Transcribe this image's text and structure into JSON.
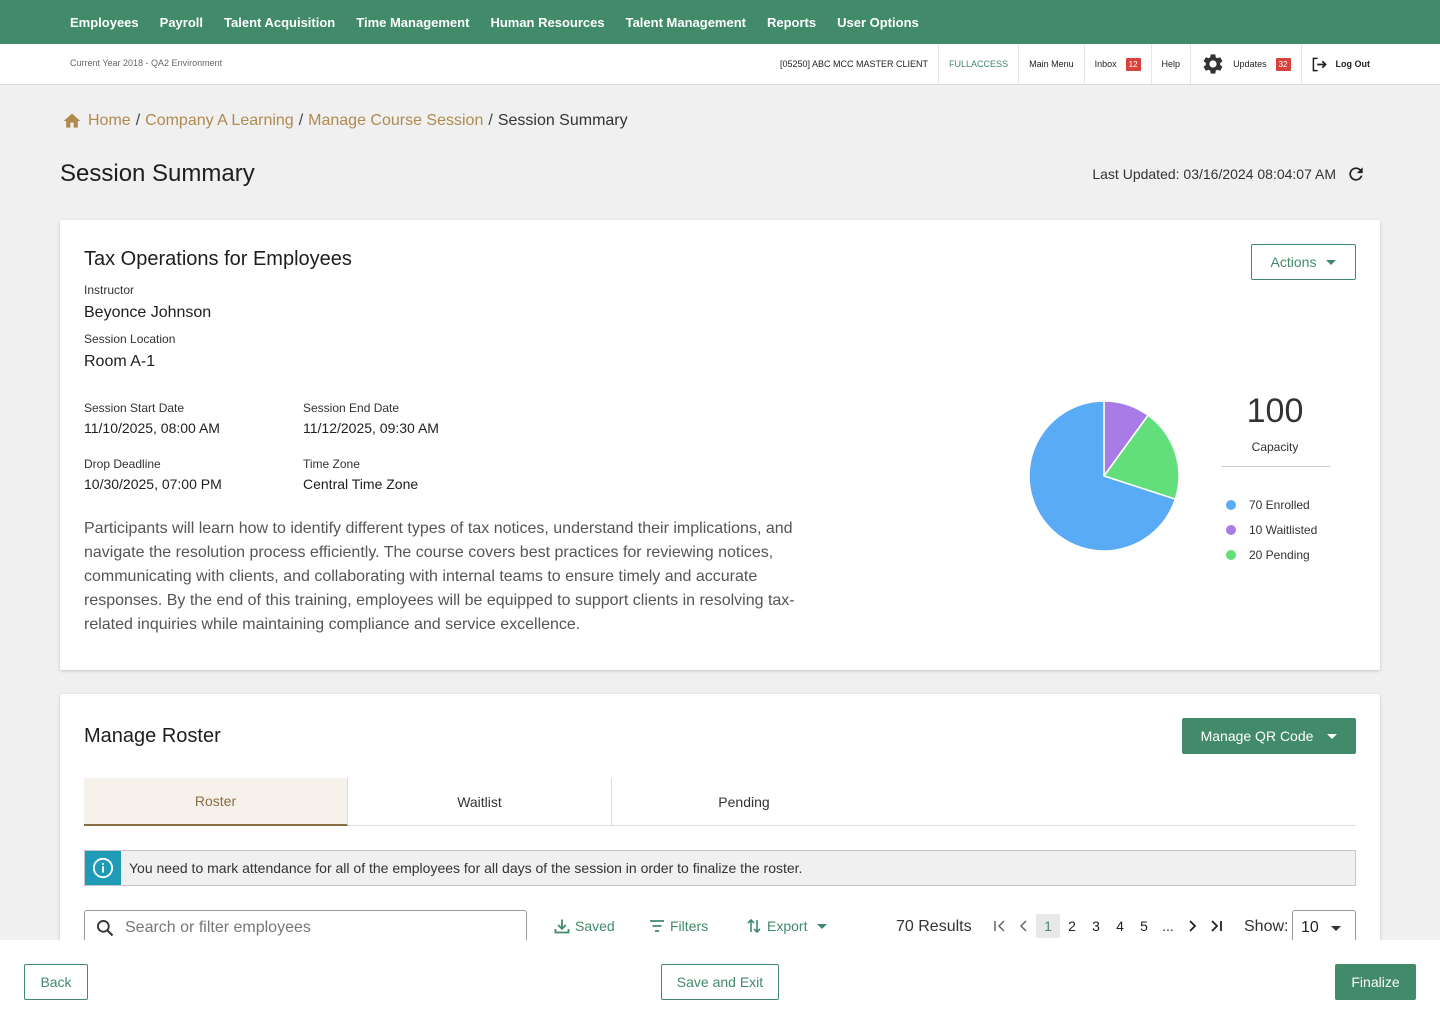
{
  "topnav": {
    "items": [
      "Employees",
      "Payroll",
      "Talent Acquisition",
      "Time Management",
      "Human Resources",
      "Talent Management",
      "Reports",
      "User Options"
    ]
  },
  "utilbar": {
    "environment": "Current Year 2018 - QA2 Environment",
    "client": "[05250] ABC MCC MASTER CLIENT",
    "access": "FULLACCESS",
    "main_menu": "Main Menu",
    "inbox": "Inbox",
    "inbox_count": "12",
    "help": "Help",
    "updates": "Updates",
    "updates_count": "32",
    "logout": "Log Out"
  },
  "breadcrumb": {
    "home": "Home",
    "company": "Company A Learning",
    "manage": "Manage Course Session",
    "current": "Session Summary",
    "separator": "/"
  },
  "page": {
    "title": "Session Summary",
    "last_updated": "Last Updated: 03/16/2024 08:04:07 AM"
  },
  "session": {
    "title": "Tax Operations for Employees",
    "instructor_label": "Instructor",
    "instructor": "Beyonce Johnson",
    "location_label": "Session Location",
    "location": "Room A-1",
    "start_label": "Session Start Date",
    "start": "11/10/2025, 08:00 AM",
    "end_label": "Session End Date",
    "end": "11/12/2025, 09:30 AM",
    "drop_label": "Drop Deadline",
    "drop": "10/30/2025, 07:00 PM",
    "tz_label": "Time Zone",
    "tz": "Central Time Zone",
    "description": "Participants will learn how to identify different types of tax notices, understand their implications, and navigate the resolution process efficiently. The course covers best practices for reviewing notices, communicating with clients, and collaborating with internal teams to ensure timely and accurate responses. By the end of this training, employees will be equipped to support clients in resolving tax-related inquiries while maintaining compliance and service excellence.",
    "actions_label": "Actions"
  },
  "capacity": {
    "value": "100",
    "label": "Capacity",
    "legend": [
      {
        "label": "70 Enrolled",
        "value": 70,
        "color": "#5aabf5"
      },
      {
        "label": "10 Waitlisted",
        "value": 10,
        "color": "#a97be6"
      },
      {
        "label": "20 Pending",
        "value": 20,
        "color": "#62de7b"
      }
    ]
  },
  "roster": {
    "title": "Manage Roster",
    "qr_label": "Manage QR Code",
    "tabs": [
      "Roster",
      "Waitlist",
      "Pending"
    ],
    "alert": "You need to mark attendance for all of the employees for all days of the session in order to finalize the roster.",
    "search_placeholder": "Search or filter employees",
    "saved": "Saved",
    "filters": "Filters",
    "export": "Export",
    "results": "70 Results",
    "pages": [
      "1",
      "2",
      "3",
      "4",
      "5",
      "..."
    ],
    "show_label": "Show:",
    "show_value": "10"
  },
  "footer": {
    "back": "Back",
    "save_exit": "Save and Exit",
    "finalize": "Finalize"
  },
  "colors": {
    "brand": "#418a6a",
    "link": "#b08a4e",
    "info": "#1f9bb5",
    "badge": "#d9413c"
  }
}
